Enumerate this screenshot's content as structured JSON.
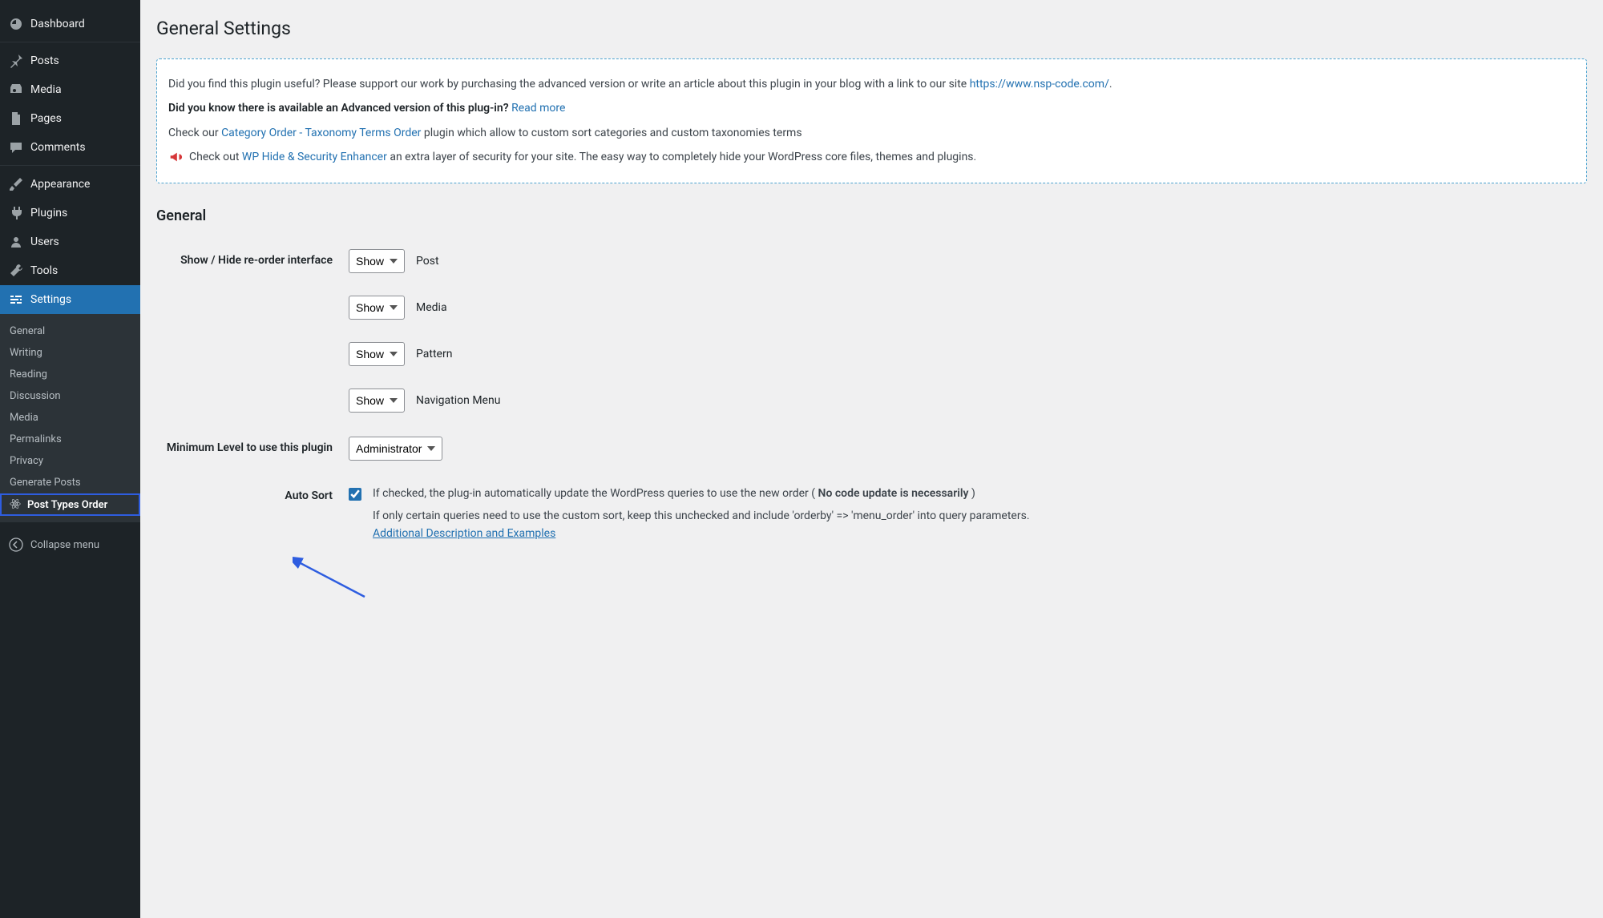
{
  "sidebar": {
    "items": [
      {
        "label": "Dashboard"
      },
      {
        "label": "Posts"
      },
      {
        "label": "Media"
      },
      {
        "label": "Pages"
      },
      {
        "label": "Comments"
      },
      {
        "label": "Appearance"
      },
      {
        "label": "Plugins"
      },
      {
        "label": "Users"
      },
      {
        "label": "Tools"
      },
      {
        "label": "Settings"
      }
    ],
    "submenu": [
      {
        "label": "General"
      },
      {
        "label": "Writing"
      },
      {
        "label": "Reading"
      },
      {
        "label": "Discussion"
      },
      {
        "label": "Media"
      },
      {
        "label": "Permalinks"
      },
      {
        "label": "Privacy"
      },
      {
        "label": "Generate Posts"
      },
      {
        "label": "Post Types Order"
      }
    ],
    "collapse": "Collapse menu"
  },
  "page": {
    "title": "General Settings"
  },
  "notice": {
    "p1_pre": "Did you find this plugin useful? Please support our work by purchasing the advanced version or write an article about this plugin in your blog with a link to our site ",
    "p1_link": "https://www.nsp-code.com/",
    "p1_post": ".",
    "p2_strong": "Did you know there is available an Advanced version of this plug-in?",
    "p2_link": "Read more",
    "p3_pre": "Check our ",
    "p3_link": "Category Order - Taxonomy Terms Order",
    "p3_post": " plugin which allow to custom sort categories and custom taxonomies terms",
    "p4_pre": "Check out ",
    "p4_link": "WP Hide & Security Enhancer",
    "p4_post": " an extra layer of security for your site. The easy way to completely hide your WordPress core files, themes and plugins."
  },
  "section": {
    "general": "General"
  },
  "form": {
    "show_hide_label": "Show / Hide re-order interface",
    "show_option": "Show",
    "types": {
      "post": "Post",
      "media": "Media",
      "pattern": "Pattern",
      "nav": "Navigation Menu"
    },
    "min_level_label": "Minimum Level to use this plugin",
    "min_level_value": "Administrator",
    "auto_sort_label": "Auto Sort",
    "auto_sort_desc_pre": "If checked, the plug-in automatically update the WordPress queries to use the new order ( ",
    "auto_sort_desc_strong": "No code update is necessarily",
    "auto_sort_desc_post": " )",
    "auto_sort_note": "If only certain queries need to use the custom sort, keep this unchecked and include 'orderby' => 'menu_order' into query parameters.",
    "auto_sort_link": "Additional Description and Examples"
  }
}
